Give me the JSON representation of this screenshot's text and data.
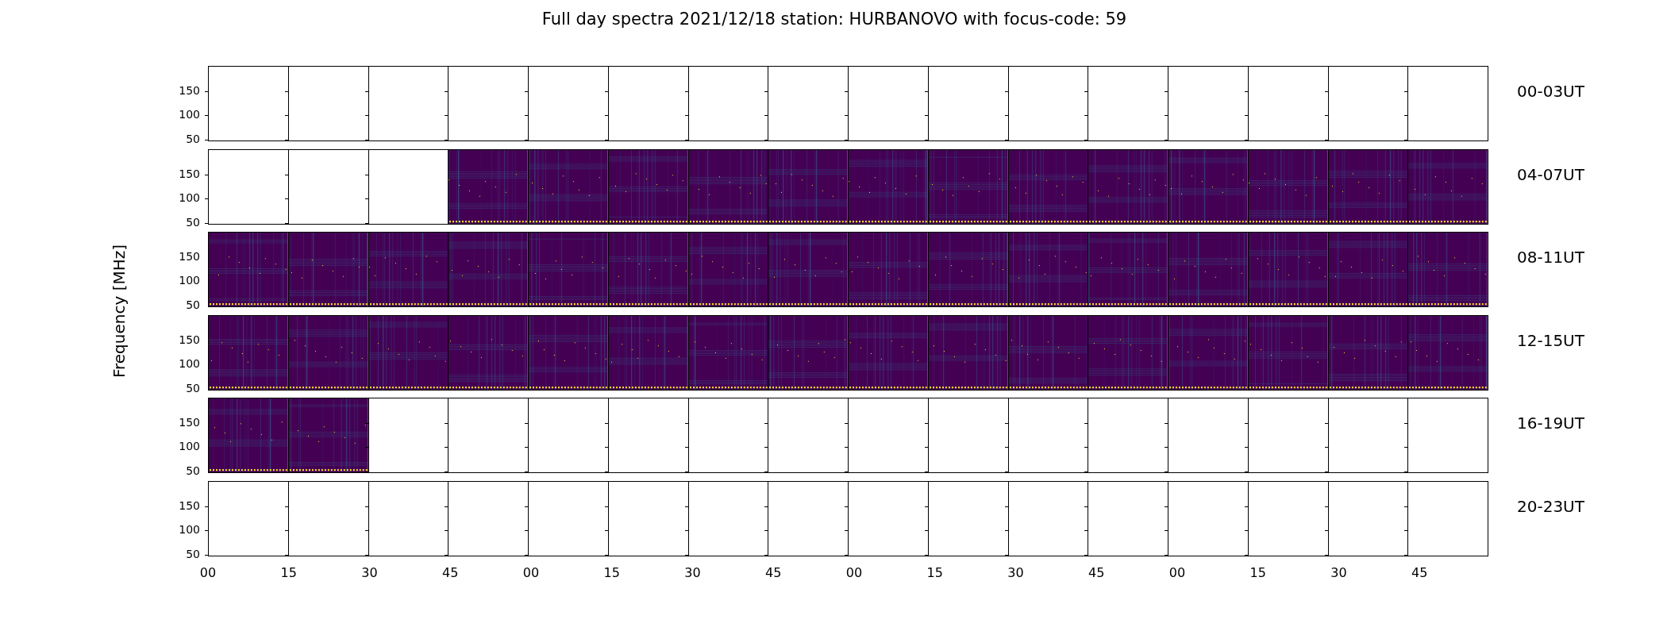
{
  "title": "Full day spectra 2021/12/18 station: HURBANOVO with focus-code: 59",
  "y_axis_label": "Frequency [MHz]",
  "rows": [
    {
      "label": "00-03UT",
      "y_ticks": [
        "150",
        "100",
        "50"
      ],
      "panels": [
        {
          "has_data": false
        },
        {
          "has_data": false
        },
        {
          "has_data": false
        },
        {
          "has_data": false
        },
        {
          "has_data": false
        },
        {
          "has_data": false
        },
        {
          "has_data": false
        },
        {
          "has_data": false
        },
        {
          "has_data": false
        },
        {
          "has_data": false
        },
        {
          "has_data": false
        },
        {
          "has_data": false
        },
        {
          "has_data": false
        },
        {
          "has_data": false
        },
        {
          "has_data": false
        },
        {
          "has_data": false
        }
      ]
    },
    {
      "label": "04-07UT",
      "y_ticks": [
        "150",
        "100",
        "50"
      ],
      "panels": [
        {
          "has_data": false
        },
        {
          "has_data": false
        },
        {
          "has_data": false
        },
        {
          "has_data": true
        },
        {
          "has_data": true
        },
        {
          "has_data": true
        },
        {
          "has_data": true
        },
        {
          "has_data": true
        },
        {
          "has_data": true
        },
        {
          "has_data": true
        },
        {
          "has_data": true
        },
        {
          "has_data": true
        },
        {
          "has_data": true
        },
        {
          "has_data": true
        },
        {
          "has_data": true
        },
        {
          "has_data": true
        }
      ]
    },
    {
      "label": "08-11UT",
      "y_ticks": [
        "150",
        "100",
        "50"
      ],
      "panels": [
        {
          "has_data": true
        },
        {
          "has_data": true
        },
        {
          "has_data": true
        },
        {
          "has_data": true
        },
        {
          "has_data": true
        },
        {
          "has_data": true
        },
        {
          "has_data": true
        },
        {
          "has_data": true
        },
        {
          "has_data": true
        },
        {
          "has_data": true
        },
        {
          "has_data": true
        },
        {
          "has_data": true
        },
        {
          "has_data": true
        },
        {
          "has_data": true
        },
        {
          "has_data": true
        },
        {
          "has_data": true
        }
      ]
    },
    {
      "label": "12-15UT",
      "y_ticks": [
        "150",
        "100",
        "50"
      ],
      "panels": [
        {
          "has_data": true
        },
        {
          "has_data": true
        },
        {
          "has_data": true
        },
        {
          "has_data": true
        },
        {
          "has_data": true
        },
        {
          "has_data": true
        },
        {
          "has_data": true
        },
        {
          "has_data": true
        },
        {
          "has_data": true
        },
        {
          "has_data": true
        },
        {
          "has_data": true
        },
        {
          "has_data": true
        },
        {
          "has_data": true
        },
        {
          "has_data": true
        },
        {
          "has_data": true
        },
        {
          "has_data": true
        }
      ]
    },
    {
      "label": "16-19UT",
      "y_ticks": [
        "150",
        "100",
        "50"
      ],
      "panels": [
        {
          "has_data": true
        },
        {
          "has_data": true
        },
        {
          "has_data": false
        },
        {
          "has_data": false
        },
        {
          "has_data": false
        },
        {
          "has_data": false
        },
        {
          "has_data": false
        },
        {
          "has_data": false
        },
        {
          "has_data": false
        },
        {
          "has_data": false
        },
        {
          "has_data": false
        },
        {
          "has_data": false
        },
        {
          "has_data": false
        },
        {
          "has_data": false
        },
        {
          "has_data": false
        },
        {
          "has_data": false
        }
      ]
    },
    {
      "label": "20-23UT",
      "y_ticks": [
        "150",
        "100",
        "50"
      ],
      "panels": [
        {
          "has_data": false
        },
        {
          "has_data": false
        },
        {
          "has_data": false
        },
        {
          "has_data": false
        },
        {
          "has_data": false
        },
        {
          "has_data": false
        },
        {
          "has_data": false
        },
        {
          "has_data": false
        },
        {
          "has_data": false
        },
        {
          "has_data": false
        },
        {
          "has_data": false
        },
        {
          "has_data": false
        },
        {
          "has_data": false
        },
        {
          "has_data": false
        },
        {
          "has_data": false
        },
        {
          "has_data": false
        }
      ]
    }
  ],
  "x_ticks": [
    "00",
    "15",
    "30",
    "45",
    "00",
    "15",
    "30",
    "45",
    "00",
    "15",
    "30",
    "45",
    "00",
    "15",
    "30",
    "45"
  ]
}
